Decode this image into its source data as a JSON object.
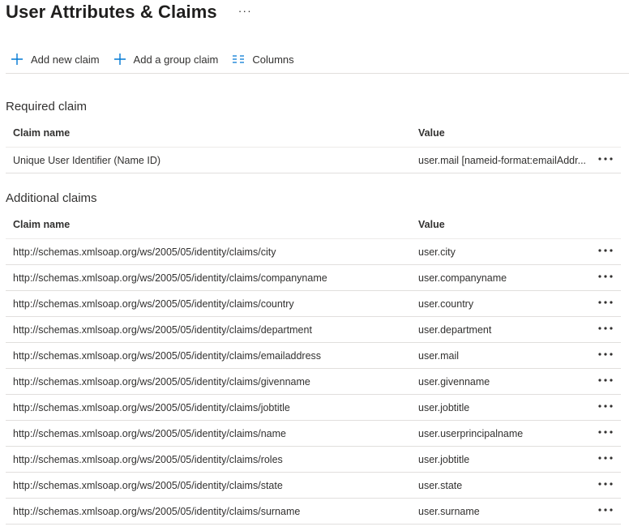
{
  "page": {
    "title": "User Attributes & Claims",
    "more_label": "···"
  },
  "toolbar": {
    "add_new_claim": "Add new claim",
    "add_group_claim": "Add a group claim",
    "columns": "Columns",
    "icons": {
      "add": "plus-icon",
      "columns": "columns-icon"
    },
    "accent_color": "#0078d4"
  },
  "required": {
    "section_title": "Required claim",
    "columns": {
      "name": "Claim name",
      "value": "Value"
    },
    "rows": [
      {
        "name": "Unique User Identifier (Name ID)",
        "value": "user.mail [nameid-format:emailAddr..."
      }
    ]
  },
  "additional": {
    "section_title": "Additional claims",
    "columns": {
      "name": "Claim name",
      "value": "Value"
    },
    "rows": [
      {
        "name": "http://schemas.xmlsoap.org/ws/2005/05/identity/claims/city",
        "value": "user.city"
      },
      {
        "name": "http://schemas.xmlsoap.org/ws/2005/05/identity/claims/companyname",
        "value": "user.companyname"
      },
      {
        "name": "http://schemas.xmlsoap.org/ws/2005/05/identity/claims/country",
        "value": "user.country"
      },
      {
        "name": "http://schemas.xmlsoap.org/ws/2005/05/identity/claims/department",
        "value": "user.department"
      },
      {
        "name": "http://schemas.xmlsoap.org/ws/2005/05/identity/claims/emailaddress",
        "value": "user.mail"
      },
      {
        "name": "http://schemas.xmlsoap.org/ws/2005/05/identity/claims/givenname",
        "value": "user.givenname"
      },
      {
        "name": "http://schemas.xmlsoap.org/ws/2005/05/identity/claims/jobtitle",
        "value": "user.jobtitle"
      },
      {
        "name": "http://schemas.xmlsoap.org/ws/2005/05/identity/claims/name",
        "value": "user.userprincipalname"
      },
      {
        "name": "http://schemas.xmlsoap.org/ws/2005/05/identity/claims/roles",
        "value": "user.jobtitle"
      },
      {
        "name": "http://schemas.xmlsoap.org/ws/2005/05/identity/claims/state",
        "value": "user.state"
      },
      {
        "name": "http://schemas.xmlsoap.org/ws/2005/05/identity/claims/surname",
        "value": "user.surname"
      }
    ]
  }
}
